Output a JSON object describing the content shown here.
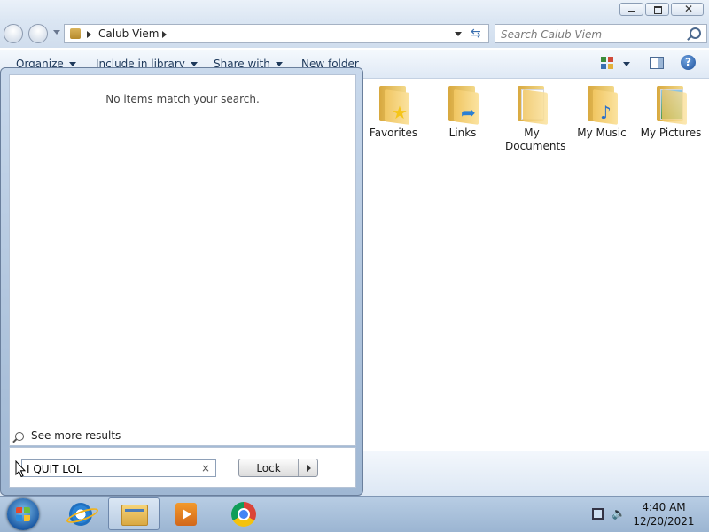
{
  "window": {
    "address": {
      "breadcrumb": "Calub Viem"
    },
    "search": {
      "placeholder": "Search Calub Viem"
    }
  },
  "toolbar": {
    "organize": "Organize",
    "include_in_library": "Include in library",
    "share_with": "Share with",
    "new_folder": "New folder"
  },
  "folders": [
    {
      "label": "Favorites",
      "icon": "star-folder-icon"
    },
    {
      "label": "Links",
      "icon": "arrow-folder-icon"
    },
    {
      "label": "My Documents",
      "icon": "documents-folder-icon"
    },
    {
      "label": "My Music",
      "icon": "music-folder-icon"
    },
    {
      "label": "My Pictures",
      "icon": "pictures-folder-icon"
    }
  ],
  "start_menu": {
    "no_results": "No items match your search.",
    "see_more": "See more results",
    "search_value": "I QUIT LOL",
    "clear_symbol": "×",
    "lock_label": "Lock"
  },
  "taskbar": {
    "apps": [
      "internet-explorer",
      "windows-explorer",
      "windows-media-player",
      "google-chrome"
    ],
    "time": "4:40 AM",
    "date": "12/20/2021"
  }
}
